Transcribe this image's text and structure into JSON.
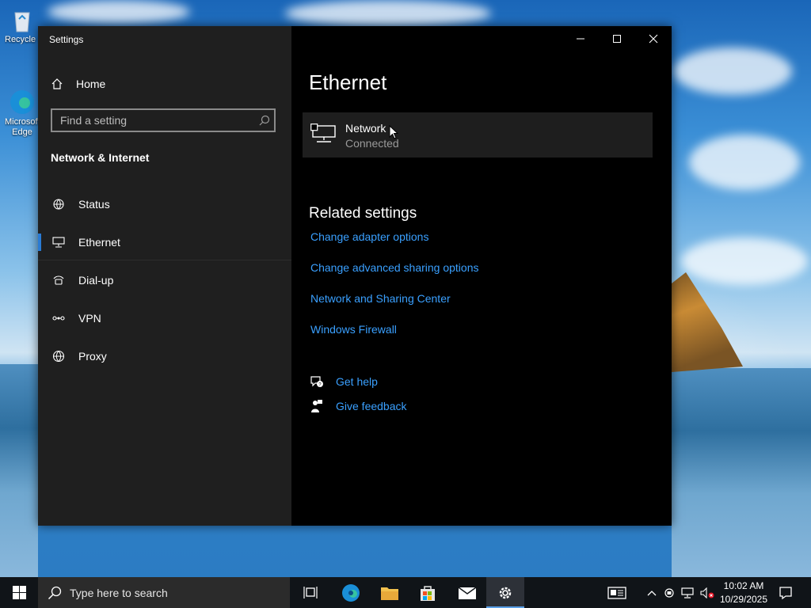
{
  "desktop": {
    "icons": [
      {
        "label": "Recycle Bin"
      },
      {
        "label": "Microsoft Edge"
      }
    ]
  },
  "window": {
    "title": "Settings",
    "controls": [
      "minimize",
      "maximize",
      "close"
    ]
  },
  "sidebar": {
    "home_label": "Home",
    "search_placeholder": "Find a setting",
    "section_title": "Network & Internet",
    "items": [
      {
        "label": "Status",
        "icon": "globe-status-icon"
      },
      {
        "label": "Ethernet",
        "icon": "ethernet-icon",
        "active": true
      },
      {
        "label": "Dial-up",
        "icon": "dial-up-icon"
      },
      {
        "label": "VPN",
        "icon": "vpn-icon"
      },
      {
        "label": "Proxy",
        "icon": "globe-icon"
      }
    ]
  },
  "main": {
    "title": "Ethernet",
    "network": {
      "name": "Network",
      "status": "Connected"
    },
    "related_title": "Related settings",
    "links": [
      "Change adapter options",
      "Change advanced sharing options",
      "Network and Sharing Center",
      "Windows Firewall"
    ],
    "help": [
      {
        "label": "Get help",
        "icon": "help-chat-icon"
      },
      {
        "label": "Give feedback",
        "icon": "feedback-icon"
      }
    ]
  },
  "taskbar": {
    "search_text": "Type here to search",
    "clock": {
      "time": "10:02 AM",
      "date": "10/29/2025"
    }
  },
  "colors": {
    "link": "#3aa0ff",
    "accent": "#2a7bd4",
    "sidebar_bg": "#1f1f1f",
    "main_bg": "#000000"
  }
}
